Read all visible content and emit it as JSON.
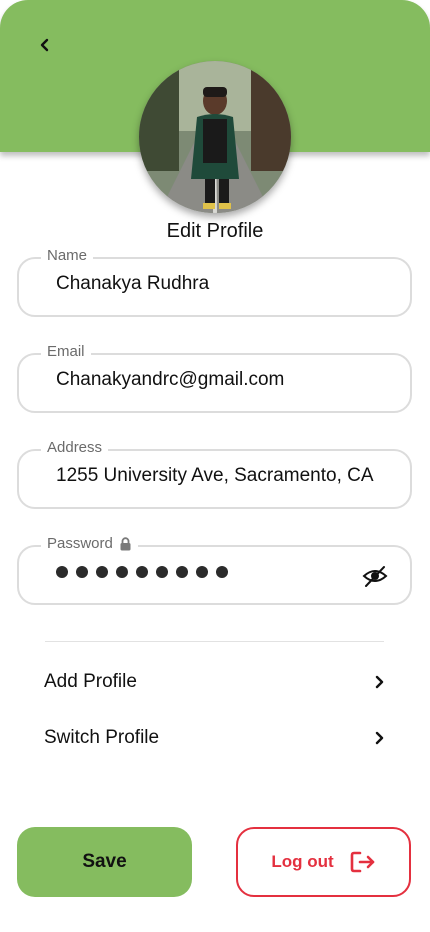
{
  "colors": {
    "accent": "#85BC5F",
    "danger": "#E4303F",
    "field_border": "#DCDCDC"
  },
  "header": {
    "back_icon": "chevron-left-icon",
    "title": "Edit Profile"
  },
  "fields": {
    "name": {
      "label": "Name",
      "value": "Chanakya Rudhra"
    },
    "email": {
      "label": "Email",
      "value": "Chanakyandrc@gmail.com"
    },
    "address": {
      "label": "Address",
      "value": "1255 University Ave, Sacramento, CA"
    },
    "password": {
      "label": "Password",
      "lock_icon": "lock-icon",
      "masked_length": 9,
      "toggle_icon": "eye-slash-icon"
    }
  },
  "menu": {
    "items": [
      {
        "label": "Add Profile",
        "icon": "chevron-right-icon"
      },
      {
        "label": "Switch Profile",
        "icon": "chevron-right-icon"
      }
    ]
  },
  "actions": {
    "save_label": "Save",
    "logout_label": "Log out",
    "logout_icon": "logout-icon"
  }
}
